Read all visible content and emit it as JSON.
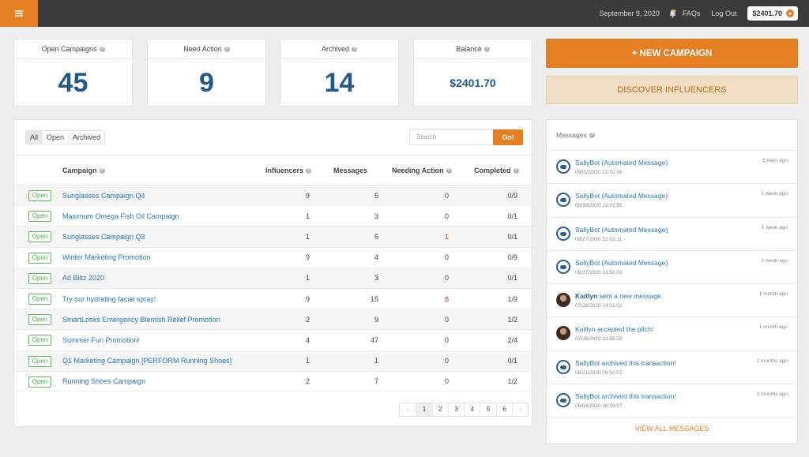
{
  "topbar": {
    "menu_icon": "hamburger-icon",
    "date": "September 9, 2020",
    "bell_icon": "bell-icon",
    "faqs": "FAQs",
    "logout": "Log Out",
    "balance": "$2401.70",
    "add_icon": "plus-icon"
  },
  "stats": [
    {
      "label": "Open Campaigns",
      "value": "45"
    },
    {
      "label": "Need Action",
      "value": "9"
    },
    {
      "label": "Archived",
      "value": "14"
    },
    {
      "label": "Balance",
      "value": "$2401.70"
    }
  ],
  "actions": {
    "new_campaign": "+ NEW CAMPAIGN",
    "discover": "DISCOVER INFLUENCERS"
  },
  "campaigns": {
    "filters": [
      "All",
      "Open",
      "Archived"
    ],
    "active_filter": "All",
    "search_placeholder": "Search",
    "go_label": "Go!",
    "headers": {
      "campaign": "Campaign",
      "influencers": "Influencers",
      "messages": "Messages",
      "needing_action": "Needing Action",
      "completed": "Completed"
    },
    "rows": [
      {
        "status": "Open",
        "name": "Sunglasses Campaign Q4",
        "influencers": "9",
        "messages": "5",
        "needing": "0",
        "completed": "0/9"
      },
      {
        "status": "Open",
        "name": "Maximum Omega Fish Oil Campaign",
        "influencers": "1",
        "messages": "3",
        "needing": "0",
        "completed": "0/1"
      },
      {
        "status": "Open",
        "name": "Sunglasses Campaign Q3",
        "influencers": "1",
        "messages": "5",
        "needing": "1",
        "completed": "0/1"
      },
      {
        "status": "Open",
        "name": "Winter Marketing Promotion",
        "influencers": "9",
        "messages": "4",
        "needing": "0",
        "completed": "0/9"
      },
      {
        "status": "Open",
        "name": "Ad Blitz 2020",
        "influencers": "1",
        "messages": "3",
        "needing": "0",
        "completed": "0/1"
      },
      {
        "status": "Open",
        "name": "Try our hydrating facial spray!",
        "influencers": "9",
        "messages": "15",
        "needing": "8",
        "completed": "1/9"
      },
      {
        "status": "Open",
        "name": "SmartLooks Emergency Blemish Relief Promotion",
        "influencers": "2",
        "messages": "9",
        "needing": "0",
        "completed": "1/2"
      },
      {
        "status": "Open",
        "name": "Summer Fun Promotion!",
        "influencers": "4",
        "messages": "47",
        "needing": "0",
        "completed": "2/4"
      },
      {
        "status": "Open",
        "name": "Q1 Marketing Campaign [PERFORM Running Shoes]",
        "influencers": "1",
        "messages": "1",
        "needing": "0",
        "completed": "0/1"
      },
      {
        "status": "Open",
        "name": "Running Shoes Campaign",
        "influencers": "2",
        "messages": "7",
        "needing": "0",
        "completed": "1/2"
      }
    ],
    "pagination": {
      "prev": "‹",
      "pages": [
        "1",
        "2",
        "3",
        "4",
        "5",
        "6"
      ],
      "current": "1",
      "next": "›"
    }
  },
  "messages": {
    "title": "Messages",
    "items": [
      {
        "avatar": "bot-avatar",
        "sender": "SallyBot (Automated Message)",
        "text": "",
        "date": "09/02/2020 22:02:06",
        "ago": "6 days ago"
      },
      {
        "avatar": "bot-avatar",
        "sender": "SallyBot (Automated Message)",
        "text": "",
        "date": "08/30/2020 22:01:55",
        "ago": "1 week ago"
      },
      {
        "avatar": "bot-avatar",
        "sender": "SallyBot (Automated Message)",
        "text": "",
        "date": "08/27/2020 22:02:11",
        "ago": "1 week ago"
      },
      {
        "avatar": "bot-avatar",
        "sender": "SallyBot (Automated Message)",
        "text": "",
        "date": "08/27/2020 13:58:02",
        "ago": "1 week ago"
      },
      {
        "avatar": "user-avatar",
        "sender": "Kaitlyn",
        "text": " sent a new message.",
        "date": "07/28/2020 14:01:01",
        "ago": "1 month ago"
      },
      {
        "avatar": "user-avatar",
        "sender": "Kaitlyn accepted the pitch!",
        "text": "",
        "date": "07/28/2020 13:58:02",
        "ago": "1 month ago"
      },
      {
        "avatar": "bot-avatar",
        "sender": "SallyBot archived this transaction!",
        "text": "",
        "date": "06/21/2020 09:50:07",
        "ago": "2 months ago"
      },
      {
        "avatar": "bot-avatar",
        "sender": "SallyBot archived this transaction!",
        "text": "",
        "date": "06/04/2020 16:09:07",
        "ago": "3 months ago"
      }
    ],
    "view_all": "VIEW ALL MESSAGES"
  },
  "colors": {
    "accent": "#e67e22",
    "stat_value": "#1f5a8a",
    "link": "#2a7ab0",
    "open_badge": "#5cb85c"
  }
}
